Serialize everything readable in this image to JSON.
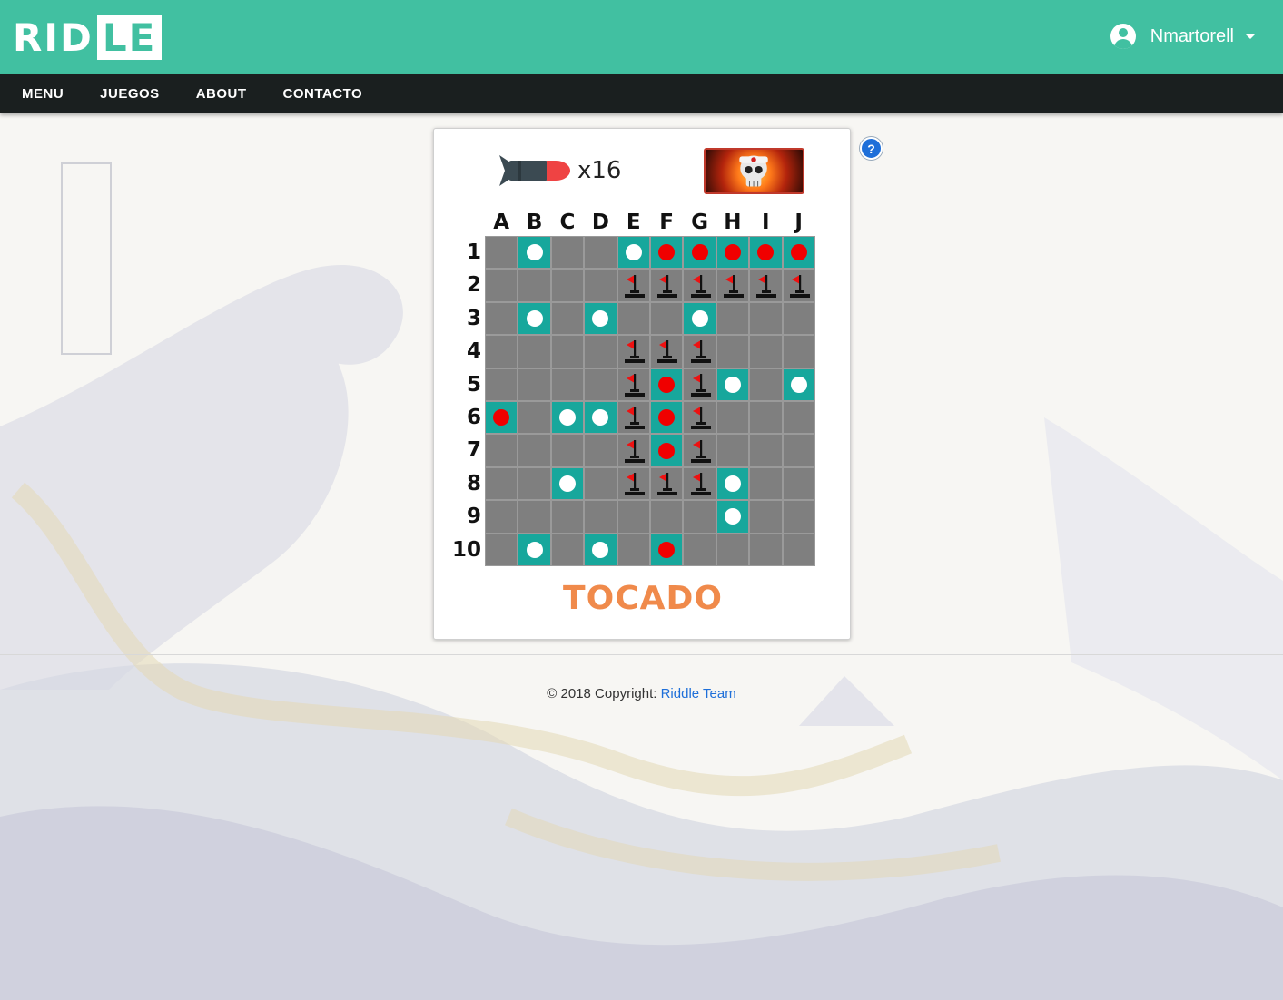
{
  "header": {
    "logo_left": "RID",
    "logo_right": "LE",
    "username": "Nmartorell"
  },
  "nav": {
    "items": [
      "MENU",
      "JUEGOS",
      "ABOUT",
      "CONTACTO"
    ]
  },
  "game": {
    "ammo_count": "x16",
    "status": "TOCADO",
    "columns": [
      "A",
      "B",
      "C",
      "D",
      "E",
      "F",
      "G",
      "H",
      "I",
      "J"
    ],
    "rows": [
      "1",
      "2",
      "3",
      "4",
      "5",
      "6",
      "7",
      "8",
      "9",
      "10"
    ],
    "legend": {
      "e": "empty",
      "w": "water (miss)",
      "h": "hit",
      "f": "sunk ship flag"
    },
    "board": [
      [
        "e",
        "w",
        "e",
        "e",
        "w",
        "h",
        "h",
        "h",
        "h",
        "h"
      ],
      [
        "e",
        "e",
        "e",
        "e",
        "f",
        "f",
        "f",
        "f",
        "f",
        "f"
      ],
      [
        "e",
        "w",
        "e",
        "w",
        "e",
        "e",
        "w",
        "e",
        "e",
        "e"
      ],
      [
        "e",
        "e",
        "e",
        "e",
        "f",
        "f",
        "f",
        "e",
        "e",
        "e"
      ],
      [
        "e",
        "e",
        "e",
        "e",
        "f",
        "h",
        "f",
        "w",
        "e",
        "w"
      ],
      [
        "h",
        "e",
        "w",
        "w",
        "f",
        "h",
        "f",
        "e",
        "e",
        "e"
      ],
      [
        "e",
        "e",
        "e",
        "e",
        "f",
        "h",
        "f",
        "e",
        "e",
        "e"
      ],
      [
        "e",
        "e",
        "w",
        "e",
        "f",
        "f",
        "f",
        "w",
        "e",
        "e"
      ],
      [
        "e",
        "e",
        "e",
        "e",
        "e",
        "e",
        "e",
        "w",
        "e",
        "e"
      ],
      [
        "e",
        "w",
        "e",
        "w",
        "e",
        "h",
        "e",
        "e",
        "e",
        "e"
      ]
    ]
  },
  "help": {
    "label": "?"
  },
  "footer": {
    "copyright": "© 2018 Copyright: ",
    "link": "Riddle Team"
  },
  "colors": {
    "header": "#41c0a1",
    "nav": "#1a1f1f",
    "water": "#17a79c",
    "hit": "#f00000",
    "empty": "#7f7f7f",
    "status": "#f08a4b"
  }
}
